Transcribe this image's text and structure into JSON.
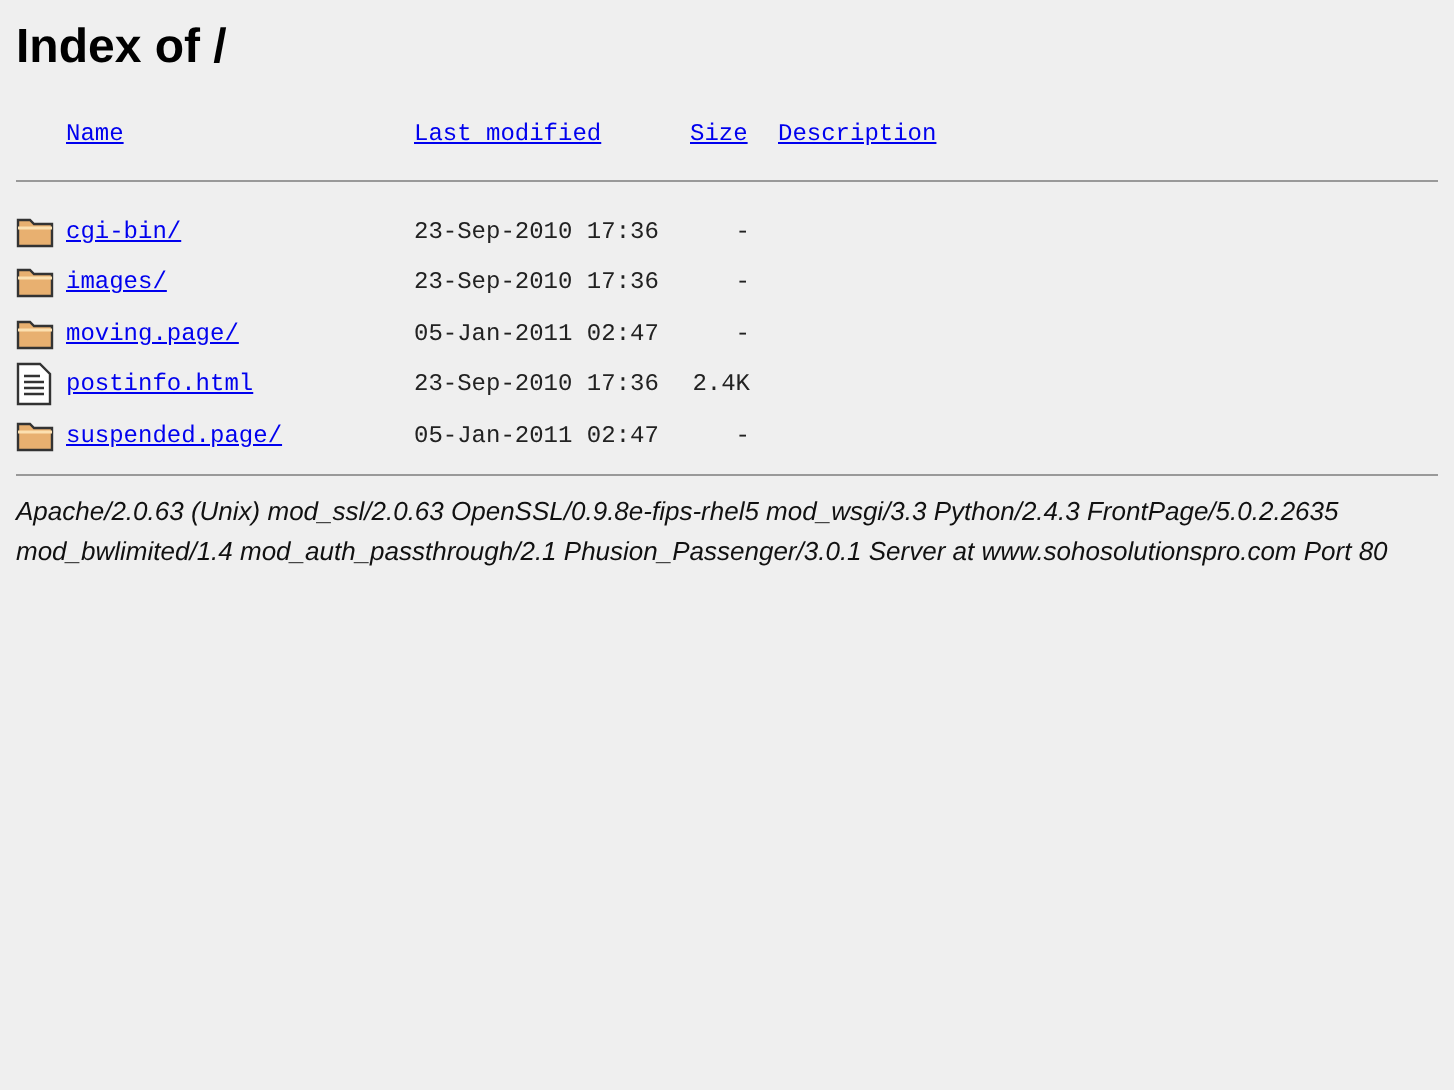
{
  "heading": "Index of /",
  "columns": [
    "Name",
    "Last modified",
    "Size",
    "Description"
  ],
  "rows": [
    {
      "kind": "folder",
      "name": "cgi-bin/",
      "modified": "23-Sep-2010 17:36",
      "size": "-"
    },
    {
      "kind": "folder",
      "name": "images/",
      "modified": "23-Sep-2010 17:36",
      "size": "-"
    },
    {
      "kind": "folder",
      "name": "moving.page/",
      "modified": "05-Jan-2011 02:47",
      "size": "-"
    },
    {
      "kind": "file",
      "name": "postinfo.html",
      "modified": "23-Sep-2010 17:36",
      "size": "2.4K"
    },
    {
      "kind": "folder",
      "name": "suspended.page/",
      "modified": "05-Jan-2011 02:47",
      "size": "-"
    }
  ],
  "server_signature": "Apache/2.0.63 (Unix) mod_ssl/2.0.63 OpenSSL/0.9.8e-fips-rhel5 mod_wsgi/3.3 Python/2.4.3 FrontPage/5.0.2.2635 mod_bwlimited/1.4 mod_auth_passthrough/2.1 Phusion_Passenger/3.0.1 Server at www.sohosolutionspro.com Port 80"
}
